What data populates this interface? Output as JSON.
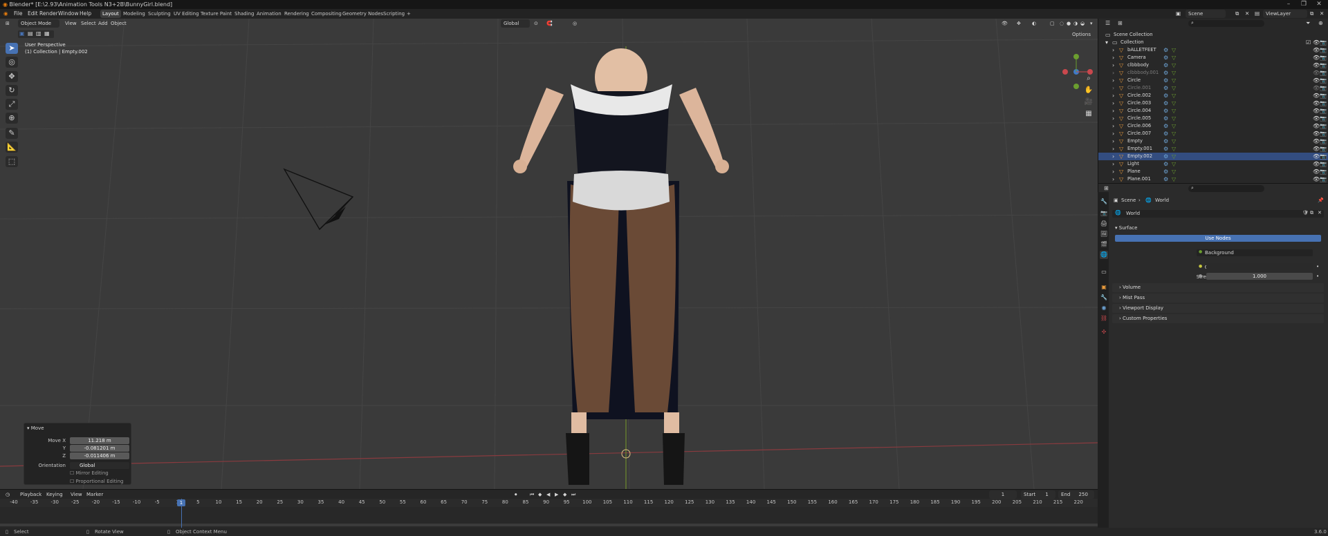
{
  "window": {
    "title": "Blender* [E:\\2.93\\Animation Tools N3+2B\\BunnyGirl.blend]",
    "controls": [
      "–",
      "❐",
      "✕"
    ]
  },
  "menu": {
    "items": [
      "File",
      "Edit",
      "Render",
      "Window",
      "Help"
    ],
    "workspaces": [
      "Layout",
      "Modeling",
      "Sculpting",
      "UV Editing",
      "Texture Paint",
      "Shading",
      "Animation",
      "Rendering",
      "Compositing",
      "Geometry Nodes",
      "Scripting",
      "+"
    ],
    "active_workspace": "Layout",
    "scene": "Scene",
    "view_layer": "ViewLayer"
  },
  "viewport": {
    "mode": "Object Mode",
    "menus": [
      "View",
      "Select",
      "Add",
      "Object"
    ],
    "orientation": "Global",
    "info_line1": "User Perspective",
    "info_line2": "(1) Collection | Empty.002",
    "options": "Options"
  },
  "move_panel": {
    "title": "Move",
    "move_x_label": "Move X",
    "move_x": "11.218 m",
    "y_label": "Y",
    "y": "-0.081201 m",
    "z_label": "Z",
    "z": "-0.011406 m",
    "orientation_label": "Orientation",
    "orientation": "Global",
    "mirror": "Mirror Editing",
    "proportional": "Proportional Editing"
  },
  "timeline": {
    "menus": [
      "Playback",
      "Keying",
      "View",
      "Marker"
    ],
    "current_frame": "1",
    "start_label": "Start",
    "start": "1",
    "end_label": "End",
    "end": "250",
    "ruler": [
      "-40",
      "-35",
      "-30",
      "-25",
      "-20",
      "-15",
      "-10",
      "-5",
      "1",
      "5",
      "10",
      "15",
      "20",
      "25",
      "30",
      "35",
      "40",
      "45",
      "50",
      "55",
      "60",
      "65",
      "70",
      "75",
      "80",
      "85",
      "90",
      "95",
      "100",
      "105",
      "110",
      "115",
      "120",
      "125",
      "130",
      "135",
      "140",
      "145",
      "150",
      "155",
      "160",
      "165",
      "170",
      "175",
      "180",
      "185",
      "190",
      "195",
      "200",
      "205",
      "210",
      "215",
      "220"
    ]
  },
  "status": {
    "select": "Select",
    "rotate": "Rotate View",
    "context": "Object Context Menu",
    "version": "3.6.0"
  },
  "outliner": {
    "scene_collection": "Scene Collection",
    "collection": "Collection",
    "items": [
      {
        "name": "bALLETFEET",
        "dim": false,
        "sel": false
      },
      {
        "name": "Camera",
        "dim": false,
        "sel": false
      },
      {
        "name": "clbbbody",
        "dim": false,
        "sel": false
      },
      {
        "name": "clbbbody.001",
        "dim": true,
        "sel": false
      },
      {
        "name": "Circle",
        "dim": false,
        "sel": false
      },
      {
        "name": "Circle.001",
        "dim": true,
        "sel": false
      },
      {
        "name": "Circle.002",
        "dim": false,
        "sel": false
      },
      {
        "name": "Circle.003",
        "dim": false,
        "sel": false
      },
      {
        "name": "Circle.004",
        "dim": false,
        "sel": false
      },
      {
        "name": "Circle.005",
        "dim": false,
        "sel": false
      },
      {
        "name": "Circle.006",
        "dim": false,
        "sel": false
      },
      {
        "name": "Circle.007",
        "dim": false,
        "sel": false
      },
      {
        "name": "Empty",
        "dim": false,
        "sel": false
      },
      {
        "name": "Empty.001",
        "dim": false,
        "sel": false
      },
      {
        "name": "Empty.002",
        "dim": false,
        "sel": true
      },
      {
        "name": "Light",
        "dim": false,
        "sel": false
      },
      {
        "name": "Plane",
        "dim": false,
        "sel": false
      },
      {
        "name": "Plane.001",
        "dim": false,
        "sel": false
      }
    ]
  },
  "properties": {
    "breadcrumb_scene": "Scene",
    "breadcrumb_world": "World",
    "world_name": "World",
    "surface_section": "Surface",
    "use_nodes": "Use Nodes",
    "surface_label": "Surface",
    "surface_value": "Background",
    "color_label": "Color",
    "strength_label": "Strength",
    "strength_value": "1.000",
    "sections": [
      "Volume",
      "Mist Pass",
      "Viewport Display",
      "Custom Properties"
    ]
  },
  "colors": {
    "accent": "#4772b3",
    "viewport": "#3a3a3a",
    "selected_row": "#334d80",
    "x_axis": "#c9484d",
    "y_axis": "#6b9e2f",
    "z_axis": "#3e7ac8"
  }
}
